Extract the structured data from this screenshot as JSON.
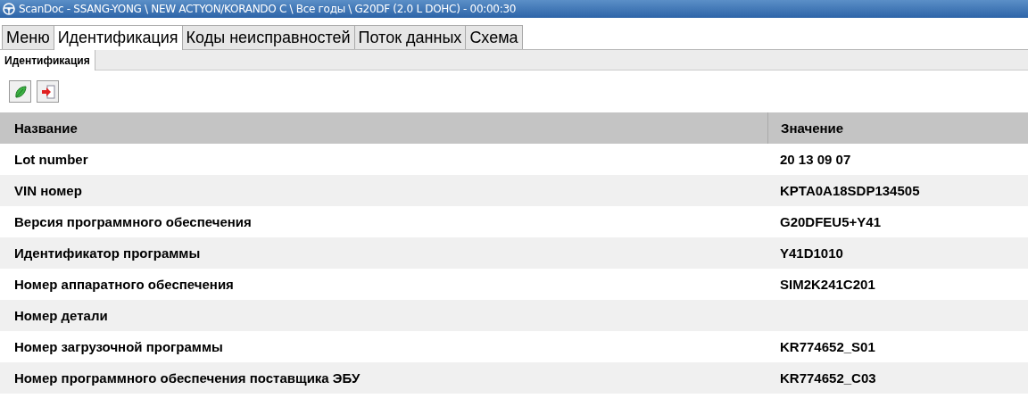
{
  "window": {
    "title": "ScanDoc - SSANG-YONG \\ NEW ACTYON/KORANDO C \\ Все годы \\ G20DF (2.0 L DOHC) - 00:00:30"
  },
  "tabs": [
    {
      "label": "Меню",
      "selected": false
    },
    {
      "label": "Идентификация",
      "selected": true
    },
    {
      "label": "Коды неисправностей",
      "selected": false
    },
    {
      "label": "Поток данных",
      "selected": false
    },
    {
      "label": "Схема",
      "selected": false
    }
  ],
  "subtabs": [
    {
      "label": "Идентификация",
      "selected": true
    }
  ],
  "table": {
    "columns": [
      "Название",
      "Значение"
    ],
    "rows": [
      {
        "name": "Lot number",
        "value": "20 13 09 07"
      },
      {
        "name": "VIN номер",
        "value": "KPTA0A18SDP134505"
      },
      {
        "name": "Версия программного обеспечения",
        "value": "G20DFEU5+Y41"
      },
      {
        "name": "Идентификатор программы",
        "value": "Y41D1010"
      },
      {
        "name": "Номер аппаратного обеспечения",
        "value": "SIM2K241C201"
      },
      {
        "name": "Номер детали",
        "value": ""
      },
      {
        "name": "Номер загрузочной программы",
        "value": "KR774652_S01"
      },
      {
        "name": "Номер программного обеспечения поставщика ЭБУ",
        "value": "KR774652_C03"
      }
    ]
  }
}
